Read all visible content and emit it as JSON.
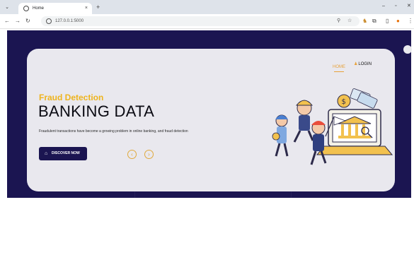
{
  "browser": {
    "tab_title": "Home",
    "tab_close": "×",
    "new_tab": "+",
    "url": "127.0.0.1:5000",
    "minimize": "–",
    "restore": "▫",
    "close": "✕"
  },
  "page": {
    "nav": {
      "home": "HOME",
      "login": "LOGIN"
    },
    "hero": {
      "kicker": "Fraud Detection",
      "title": "BANKING DATA",
      "description": "Fraudulent transactions have become a growing problem in online banking, and fraud detection",
      "cta_label": "DISCOVER NOW"
    },
    "colors": {
      "hero_background": "#1b1551",
      "card_background": "#e9e8ee",
      "accent": "#eeb41e",
      "button": "#1b1551"
    }
  }
}
